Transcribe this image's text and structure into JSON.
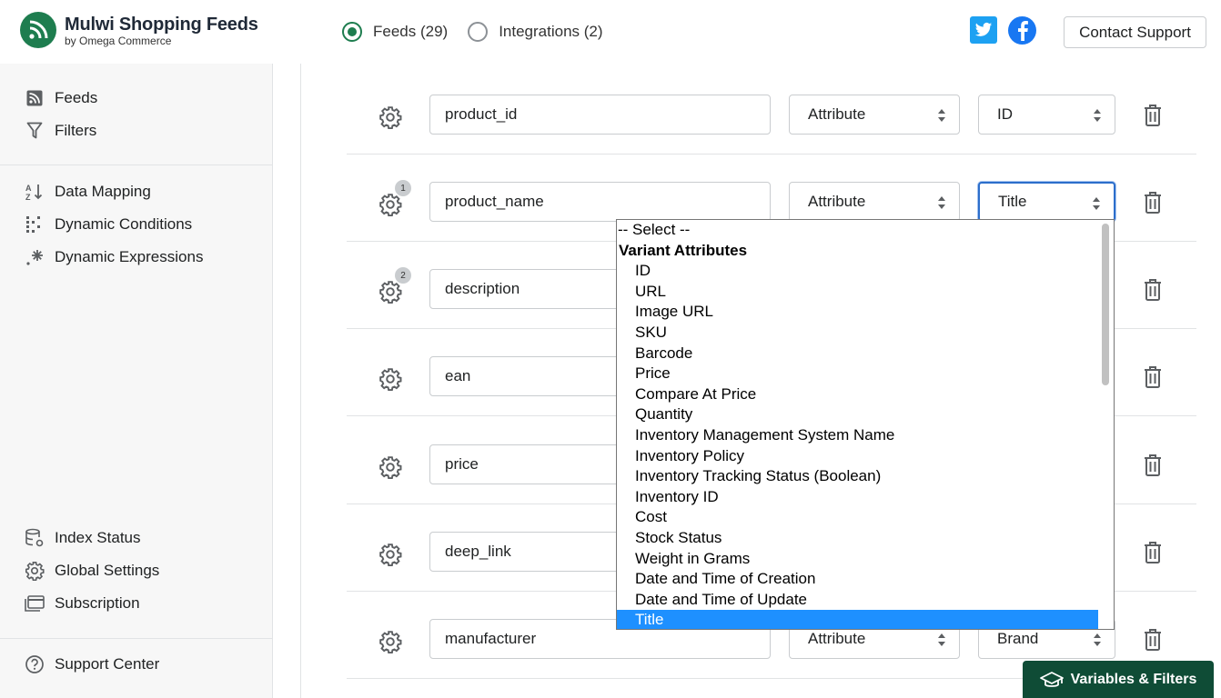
{
  "brand": {
    "title": "Mulwi Shopping Feeds",
    "subtitle": "by Omega Commerce"
  },
  "tabs": [
    {
      "label": "Feeds (29)",
      "selected": true
    },
    {
      "label": "Integrations (2)",
      "selected": false
    }
  ],
  "header": {
    "contact_label": "Contact Support"
  },
  "sidebar": {
    "group1": [
      {
        "label": "Feeds",
        "icon": "rss-icon"
      },
      {
        "label": "Filters",
        "icon": "filter-icon"
      }
    ],
    "group2": [
      {
        "label": "Data Mapping",
        "icon": "sort-icon"
      },
      {
        "label": "Dynamic Conditions",
        "icon": "conditions-icon"
      },
      {
        "label": "Dynamic Expressions",
        "icon": "sparkle-icon"
      }
    ],
    "group3": [
      {
        "label": "Index Status",
        "icon": "database-icon"
      },
      {
        "label": "Global Settings",
        "icon": "gear-icon"
      },
      {
        "label": "Subscription",
        "icon": "card-icon"
      }
    ],
    "group4": [
      {
        "label": "Support Center",
        "icon": "question-icon"
      }
    ]
  },
  "rows": [
    {
      "name": "product_id",
      "type": "Attribute",
      "value": "ID",
      "badge": ""
    },
    {
      "name": "product_name",
      "type": "Attribute",
      "value": "Title",
      "badge": "1"
    },
    {
      "name": "description",
      "type": "",
      "value": "",
      "badge": "2"
    },
    {
      "name": "ean",
      "type": "",
      "value": "",
      "badge": ""
    },
    {
      "name": "price",
      "type": "",
      "value": "",
      "badge": ""
    },
    {
      "name": "deep_link",
      "type": "",
      "value": "",
      "badge": ""
    },
    {
      "name": "manufacturer",
      "type": "Attribute",
      "value": "Brand",
      "badge": ""
    }
  ],
  "dropdown": {
    "placeholder": "-- Select --",
    "group_label": "Variant Attributes",
    "options": [
      "ID",
      "URL",
      "Image URL",
      "SKU",
      "Barcode",
      "Price",
      "Compare At Price",
      "Quantity",
      "Inventory Management System Name",
      "Inventory Policy",
      "Inventory Tracking Status (Boolean)",
      "Inventory ID",
      "Cost",
      "Stock Status",
      "Weight in Grams",
      "Date and Time of Creation",
      "Date and Time of Update",
      "Title"
    ],
    "selected": "Title"
  },
  "footer": {
    "variables_label": "Variables & Filters"
  },
  "colors": {
    "brand_green": "#1e7d4f",
    "twitter": "#1da1f2",
    "facebook": "#1877f2",
    "selected_option": "#1e90ff"
  }
}
